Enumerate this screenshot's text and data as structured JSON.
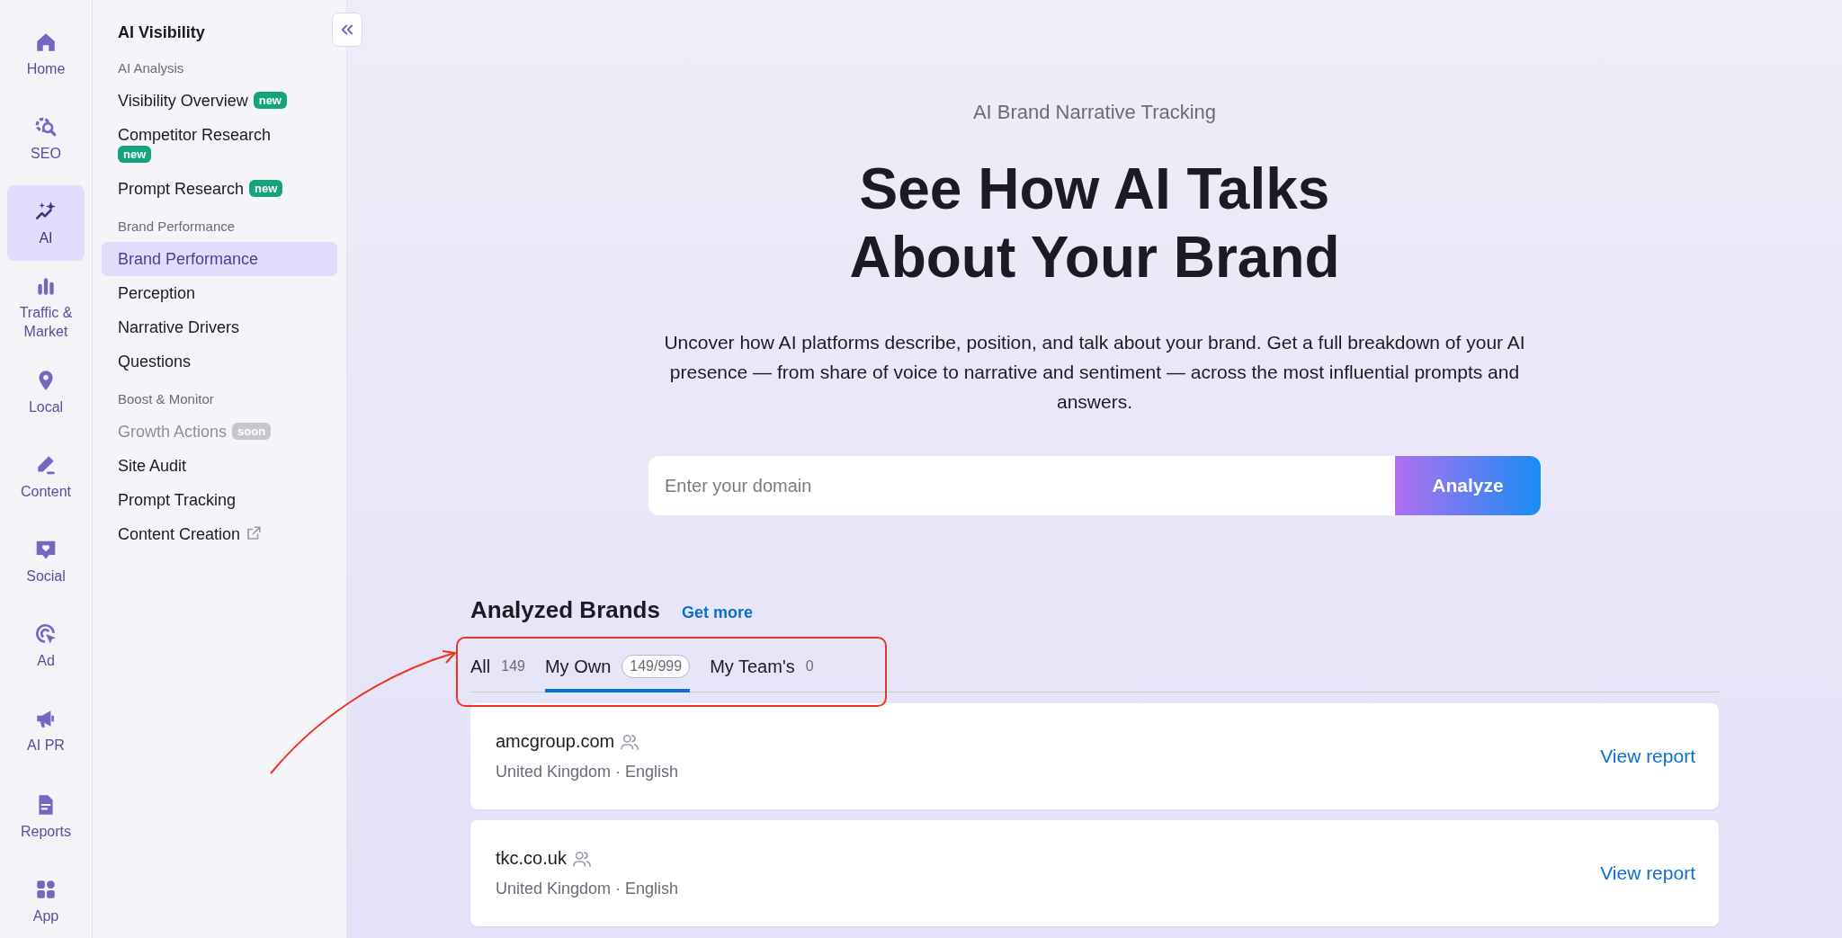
{
  "rail": {
    "items": [
      {
        "label": "Home",
        "selected": false
      },
      {
        "label": "SEO",
        "selected": false
      },
      {
        "label": "AI",
        "selected": true
      },
      {
        "label": "Traffic & Market",
        "selected": false
      },
      {
        "label": "Local",
        "selected": false
      },
      {
        "label": "Content",
        "selected": false
      },
      {
        "label": "Social",
        "selected": false
      },
      {
        "label": "Ad",
        "selected": false
      },
      {
        "label": "AI PR",
        "selected": false
      },
      {
        "kind": "divider"
      },
      {
        "label": "Reports",
        "selected": false
      },
      {
        "label": "App",
        "selected": false
      }
    ]
  },
  "sidebar": {
    "title": "AI Visibility",
    "sections": [
      {
        "heading": "AI Analysis",
        "items": [
          {
            "label": "Visibility Overview",
            "badge": "new",
            "selected": false,
            "disabled": false
          },
          {
            "label": "Competitor Research",
            "badge": "new",
            "selected": false,
            "disabled": false
          },
          {
            "label": "Prompt Research",
            "badge": "new",
            "selected": false,
            "disabled": false
          }
        ]
      },
      {
        "heading": "Brand Performance",
        "items": [
          {
            "label": "Brand Performance",
            "selected": true,
            "disabled": false
          },
          {
            "label": "Perception",
            "selected": false,
            "disabled": false
          },
          {
            "label": "Narrative Drivers",
            "selected": false,
            "disabled": false
          },
          {
            "label": "Questions",
            "selected": false,
            "disabled": false
          }
        ]
      },
      {
        "heading": "Boost & Monitor",
        "items": [
          {
            "label": "Growth Actions",
            "badge": "soon",
            "selected": false,
            "disabled": true
          },
          {
            "label": "Site Audit",
            "selected": false,
            "disabled": false
          },
          {
            "label": "Prompt Tracking",
            "selected": false,
            "disabled": false
          },
          {
            "label": "Content Creation",
            "external": true,
            "selected": false,
            "disabled": false
          }
        ]
      }
    ]
  },
  "hero": {
    "eyebrow": "AI Brand Narrative Tracking",
    "headline_lines": [
      "See How AI Talks",
      "About Your Brand"
    ],
    "description": "Uncover how AI platforms describe, position, and talk about your brand. Get a full breakdown of your AI presence — from share of voice to narrative and sentiment — across the most influential prompts and answers.",
    "search": {
      "placeholder": "Enter your domain",
      "button": "Analyze"
    }
  },
  "brands": {
    "title": "Analyzed Brands",
    "link": "Get more",
    "tabs": [
      {
        "label": "All",
        "count": "149",
        "selected": false
      },
      {
        "label": "My Own",
        "count": "149/999",
        "selected": true
      },
      {
        "label": "My Team's",
        "count": "0",
        "selected": false
      }
    ],
    "rows": [
      {
        "domain": "amcgroup.com",
        "shared": true,
        "meta": "United Kingdom · English",
        "action": "View report"
      },
      {
        "domain": "tkc.co.uk",
        "shared": true,
        "meta": "United Kingdom · English",
        "action": "View report"
      }
    ]
  }
}
